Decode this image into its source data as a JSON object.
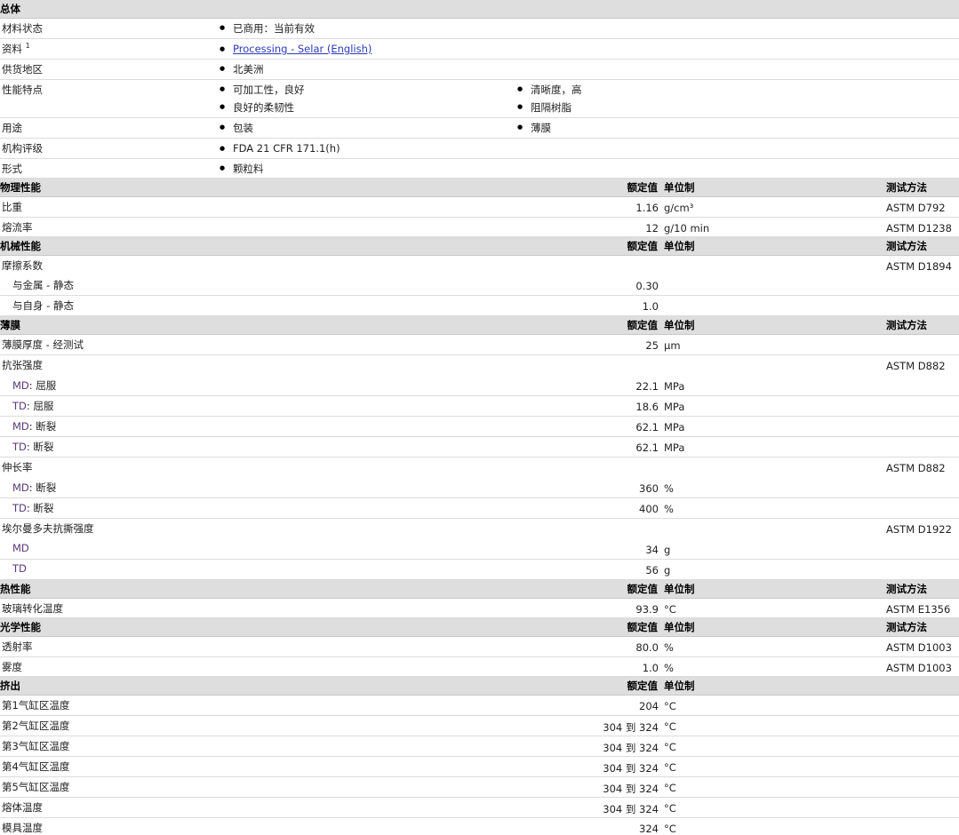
{
  "general": {
    "title": "总体",
    "material_status": {
      "label": "材料状态",
      "value": "已商用：当前有效"
    },
    "literature": {
      "label": "资料",
      "sup": "1",
      "link": "Processing - Selar (English)"
    },
    "availability": {
      "label": "供货地区",
      "value": "北美洲"
    },
    "features": {
      "label": "性能特点",
      "items": [
        "可加工性，良好",
        "清晰度，高",
        "良好的柔韧性",
        "阻隔树脂"
      ]
    },
    "uses": {
      "label": "用途",
      "items": [
        "包装",
        "薄膜"
      ]
    },
    "agency": {
      "label": "机构评级",
      "value": "FDA 21 CFR 171.1(h)"
    },
    "form": {
      "label": "形式",
      "value": "颗粒料"
    }
  },
  "col": {
    "nominal": "额定值",
    "unit": "单位制",
    "test": "测试方法"
  },
  "physical": {
    "title": "物理性能",
    "rows": [
      {
        "label": "比重",
        "value": "1.16",
        "unit": "g/cm³",
        "test": "ASTM D792"
      },
      {
        "label": "熔流率",
        "value": "12",
        "unit": "g/10 min",
        "test": "ASTM D1238"
      }
    ]
  },
  "mechanical": {
    "title": "机械性能",
    "friction": {
      "label": "摩擦系数",
      "test": "ASTM D1894"
    },
    "rows": [
      {
        "label": "与金属 - 静态",
        "value": "0.30"
      },
      {
        "label": "与自身 - 静态",
        "value": "1.0"
      }
    ]
  },
  "film": {
    "title": "薄膜",
    "thickness": {
      "label": "薄膜厚度 - 经测试",
      "value": "25",
      "unit": "µm"
    },
    "tensile": {
      "label": "抗张强度",
      "test": "ASTM D882",
      "rows": [
        {
          "pre": "MD",
          "label": ": 屈服",
          "value": "22.1",
          "unit": "MPa"
        },
        {
          "pre": "TD",
          "label": ": 屈服",
          "value": "18.6",
          "unit": "MPa"
        },
        {
          "pre": "MD",
          "label": ": 断裂",
          "value": "62.1",
          "unit": "MPa"
        },
        {
          "pre": "TD",
          "label": ": 断裂",
          "value": "62.1",
          "unit": "MPa"
        }
      ]
    },
    "elongation": {
      "label": "伸长率",
      "test": "ASTM D882",
      "rows": [
        {
          "pre": "MD",
          "label": ": 断裂",
          "value": "360",
          "unit": "%"
        },
        {
          "pre": "TD",
          "label": ": 断裂",
          "value": "400",
          "unit": "%"
        }
      ]
    },
    "tear": {
      "label": "埃尔曼多夫抗撕强度",
      "test": "ASTM D1922",
      "rows": [
        {
          "pre": "MD",
          "value": "34",
          "unit": "g"
        },
        {
          "pre": "TD",
          "value": "56",
          "unit": "g"
        }
      ]
    }
  },
  "thermal": {
    "title": "热性能",
    "rows": [
      {
        "label": "玻璃转化温度",
        "value": "93.9",
        "unit": "°C",
        "test": "ASTM E1356"
      }
    ]
  },
  "optical": {
    "title": "光学性能",
    "rows": [
      {
        "label": "透射率",
        "value": "80.0",
        "unit": "%",
        "test": "ASTM D1003"
      },
      {
        "label": "雾度",
        "value": "1.0",
        "unit": "%",
        "test": "ASTM D1003"
      }
    ]
  },
  "extrusion": {
    "title": "挤出",
    "rows": [
      {
        "label": "第1气缸区温度",
        "value": "204",
        "unit": "°C"
      },
      {
        "label": "第2气缸区温度",
        "value": "304 到  324",
        "unit": "°C"
      },
      {
        "label": "第3气缸区温度",
        "value": "304 到  324",
        "unit": "°C"
      },
      {
        "label": "第4气缸区温度",
        "value": "304 到  324",
        "unit": "°C"
      },
      {
        "label": "第5气缸区温度",
        "value": "304 到  324",
        "unit": "°C"
      },
      {
        "label": "熔体温度",
        "value": "304 到  324",
        "unit": "°C"
      },
      {
        "label": "模具温度",
        "value": "324",
        "unit": "°C"
      }
    ]
  }
}
